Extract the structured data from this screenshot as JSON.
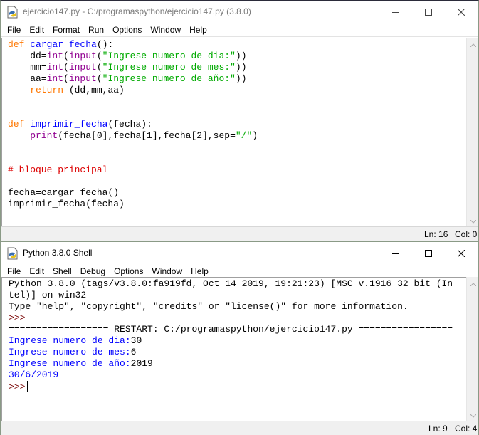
{
  "editor": {
    "title": "ejercicio147.py - C:/programaspython/ejercicio147.py (3.8.0)",
    "menu": [
      "File",
      "Edit",
      "Format",
      "Run",
      "Options",
      "Window",
      "Help"
    ],
    "code_lines": [
      [
        {
          "t": "def",
          "c": "kw"
        },
        {
          "t": " "
        },
        {
          "t": "cargar_fecha",
          "c": "def"
        },
        {
          "t": "():"
        }
      ],
      [
        {
          "t": "    dd="
        },
        {
          "t": "int",
          "c": "bi"
        },
        {
          "t": "("
        },
        {
          "t": "input",
          "c": "bi"
        },
        {
          "t": "("
        },
        {
          "t": "\"Ingrese numero de dia:\"",
          "c": "str"
        },
        {
          "t": "))"
        }
      ],
      [
        {
          "t": "    mm="
        },
        {
          "t": "int",
          "c": "bi"
        },
        {
          "t": "("
        },
        {
          "t": "input",
          "c": "bi"
        },
        {
          "t": "("
        },
        {
          "t": "\"Ingrese numero de mes:\"",
          "c": "str"
        },
        {
          "t": "))"
        }
      ],
      [
        {
          "t": "    aa="
        },
        {
          "t": "int",
          "c": "bi"
        },
        {
          "t": "("
        },
        {
          "t": "input",
          "c": "bi"
        },
        {
          "t": "("
        },
        {
          "t": "\"Ingrese numero de año:\"",
          "c": "str"
        },
        {
          "t": "))"
        }
      ],
      [
        {
          "t": "    "
        },
        {
          "t": "return",
          "c": "kw"
        },
        {
          "t": " (dd,mm,aa)"
        }
      ],
      [],
      [],
      [
        {
          "t": "def",
          "c": "kw"
        },
        {
          "t": " "
        },
        {
          "t": "imprimir_fecha",
          "c": "def"
        },
        {
          "t": "(fecha):"
        }
      ],
      [
        {
          "t": "    "
        },
        {
          "t": "print",
          "c": "bi"
        },
        {
          "t": "(fecha[0],fecha[1],fecha[2],sep="
        },
        {
          "t": "\"/\"",
          "c": "str"
        },
        {
          "t": ")"
        }
      ],
      [],
      [],
      [
        {
          "t": "# bloque principal",
          "c": "cmt"
        }
      ],
      [],
      [
        {
          "t": "fecha=cargar_fecha()"
        }
      ],
      [
        {
          "t": "imprimir_fecha(fecha)"
        }
      ]
    ],
    "status": {
      "ln": "Ln: 16",
      "col": "Col: 0"
    }
  },
  "shell": {
    "title": "Python 3.8.0 Shell",
    "menu": [
      "File",
      "Edit",
      "Shell",
      "Debug",
      "Options",
      "Window",
      "Help"
    ],
    "lines": [
      [
        {
          "t": "Python 3.8.0 (tags/v3.8.0:fa919fd, Oct 14 2019, 19:21:23) [MSC v.1916 32 bit (In"
        }
      ],
      [
        {
          "t": "tel)] on win32"
        }
      ],
      [
        {
          "t": "Type \"help\", \"copyright\", \"credits\" or \"license()\" for more information."
        }
      ],
      [
        {
          "t": ">>> ",
          "c": "prompt"
        }
      ],
      [
        {
          "t": "================== RESTART: C:/programaspython/ejercicio147.py ================="
        }
      ],
      [
        {
          "t": "Ingrese numero de dia:",
          "c": "out"
        },
        {
          "t": "30"
        }
      ],
      [
        {
          "t": "Ingrese numero de mes:",
          "c": "out"
        },
        {
          "t": "6"
        }
      ],
      [
        {
          "t": "Ingrese numero de año:",
          "c": "out"
        },
        {
          "t": "2019"
        }
      ],
      [
        {
          "t": "30/6/2019",
          "c": "out"
        }
      ]
    ],
    "prompt": ">>>",
    "status": {
      "ln": "Ln: 9",
      "col": "Col: 4"
    }
  },
  "icons": {
    "app": "python-idle-icon",
    "minimize": "minimize-icon",
    "maximize": "maximize-icon",
    "close": "close-icon"
  }
}
